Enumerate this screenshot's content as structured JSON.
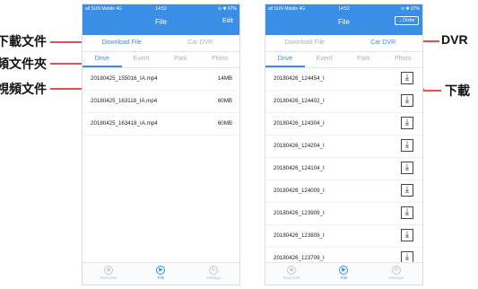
{
  "status_bar": {
    "carrier": "all SUN Mobile 4G",
    "time": "14:52",
    "battery": "⊙ ✱ 97%"
  },
  "left_screen": {
    "nav_title": "File",
    "nav_action": "Edit",
    "segments": [
      "Download File",
      "Car DVR"
    ],
    "active_segment": 0,
    "tabs": [
      "Drive",
      "Event",
      "Park",
      "Photo"
    ],
    "active_tab": 0,
    "files": [
      {
        "name": "20180425_155016_IA.mp4",
        "size": "14MB"
      },
      {
        "name": "20180425_163118_IA.mp4",
        "size": "60MB"
      },
      {
        "name": "20180425_163418_IA.mp4",
        "size": "60MB"
      }
    ]
  },
  "right_screen": {
    "nav_title": "File",
    "nav_action": "Order",
    "segments": [
      "Download File",
      "Car DVR"
    ],
    "active_segment": 1,
    "tabs": [
      "Drive",
      "Event",
      "Park",
      "Photo"
    ],
    "active_tab": 0,
    "files": [
      "20180426_124454_I",
      "20180426_124402_I",
      "20180426_124304_I",
      "20180426_124204_I",
      "20180426_124104_I",
      "20180426_124009_I",
      "20180426_123909_I",
      "20180426_123809_I",
      "20180426_123709_I"
    ],
    "download_glyph": "⤓"
  },
  "bottom_tabs": [
    {
      "label": "Real time",
      "icon": "camera-icon"
    },
    {
      "label": "File",
      "icon": "play-icon"
    },
    {
      "label": "Settings",
      "icon": "gear-icon"
    }
  ],
  "callouts": {
    "downloaded_files": "下載文件",
    "video_folder": "頻文件夾",
    "video_file": "視頻文件",
    "dvr": "DVR",
    "download": "下載"
  },
  "colors": {
    "accent": "#3a8ee6",
    "callout": "#d9534f"
  }
}
